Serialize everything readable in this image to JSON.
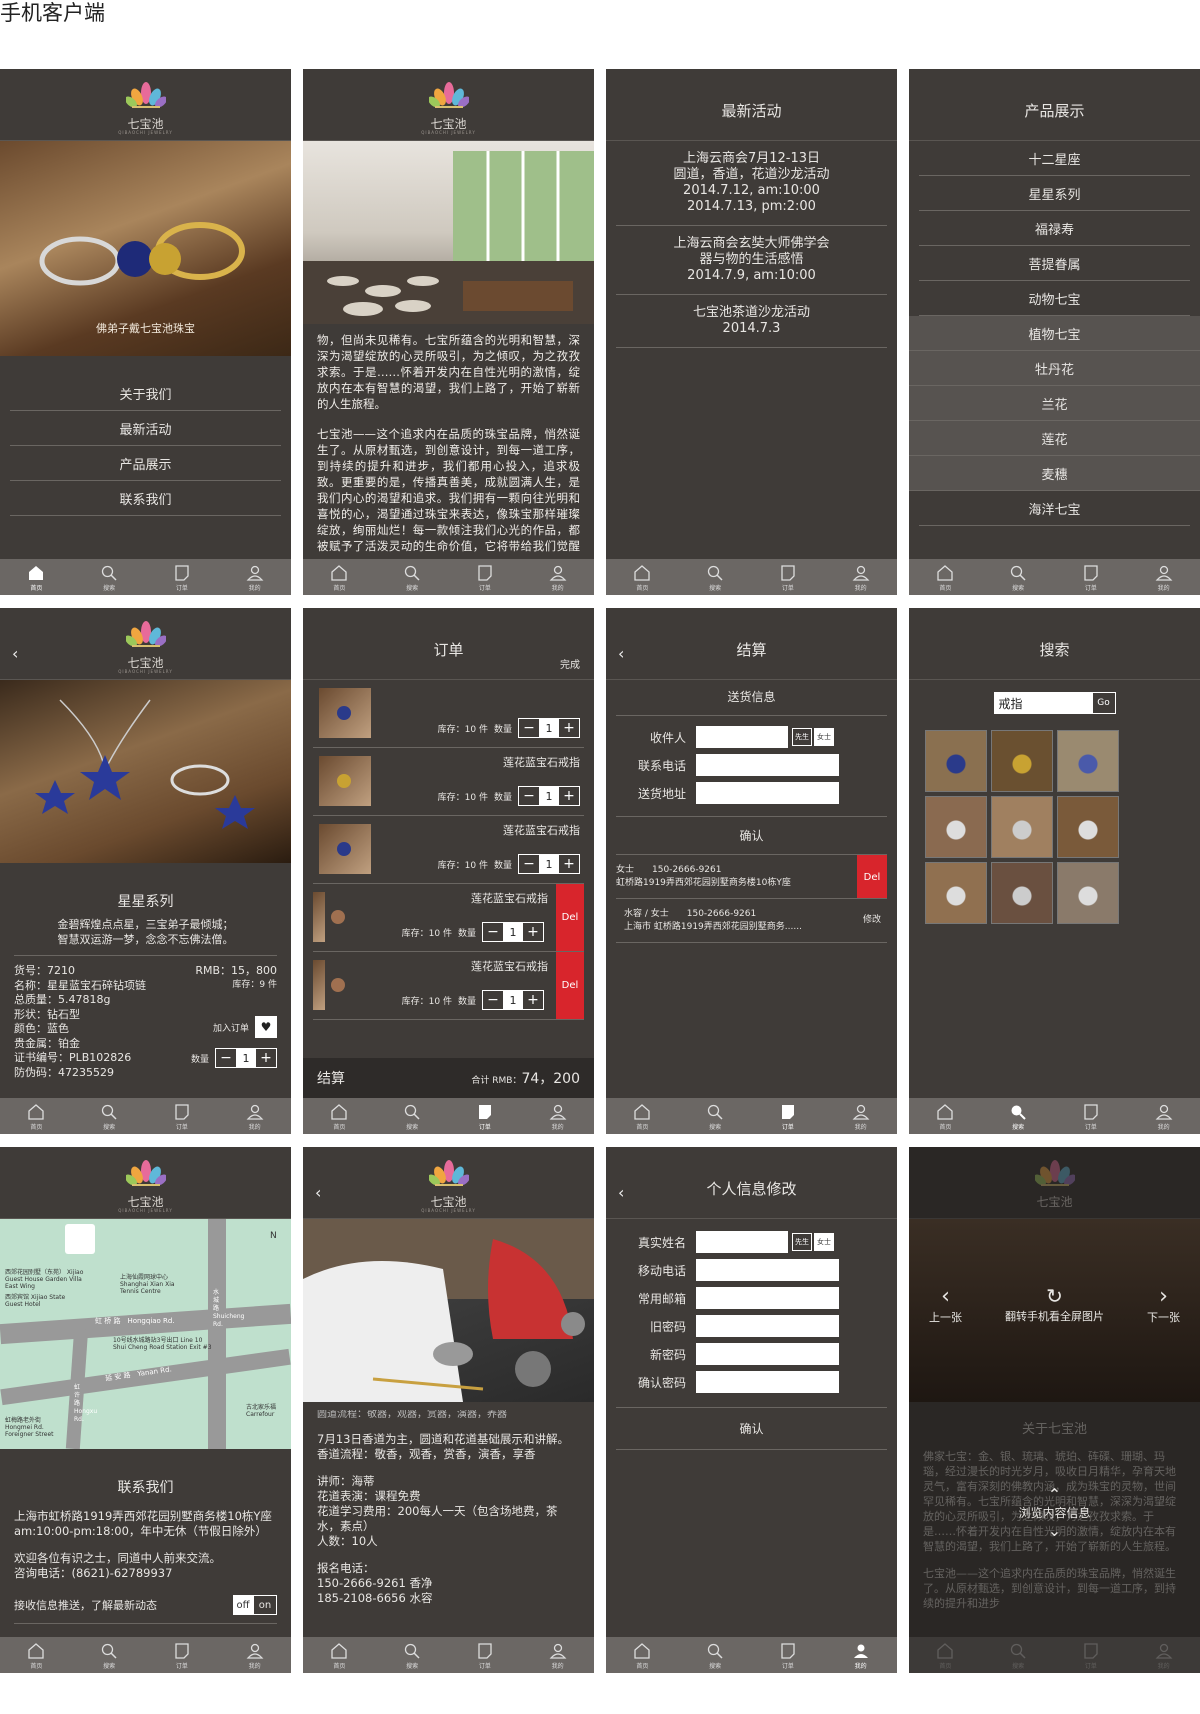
{
  "page_title": "手机客户端",
  "brand": {
    "name": "七宝池",
    "sub": "QIBAOCHI JEWELRY"
  },
  "tabs": [
    {
      "label": "首页",
      "icon": "home-icon"
    },
    {
      "label": "搜索",
      "icon": "search-icon"
    },
    {
      "label": "订单",
      "icon": "order-icon"
    },
    {
      "label": "我的",
      "icon": "user-icon"
    }
  ],
  "home": {
    "photo_caption": "佛弟子戴七宝池珠宝",
    "menu": [
      "关于我们",
      "最新活动",
      "产品展示",
      "联系我们"
    ]
  },
  "about": {
    "p1": "物，但尚未见稀有。七宝所蕴含的光明和智慧，深深为渴望绽放的心灵所吸引，为之倾叹，为之孜孜求索。于是……怀着开发内在自性光明的激情，绽放内在本有智慧的渴望，我们上路了，开始了崭新的人生旅程。",
    "p2": "七宝池——这个追求内在品质的珠宝品牌，悄然诞生了。从原材甄选，到创意设计，到每一道工序，到持续的提升和进步，我们都用心投入，追求极致。更重要的是，传播真善美，成就圆满人生，是我们内心的渴望和追求。我们拥有一颗向往光明和喜悦的心，渴望通过珠宝来表达，像珠宝那样璀璨绽放，绚丽灿烂！每一款倾注我们心光的作品，都被赋予了活泼灵动的生命价值，它将带给我们觉醒和智慧的光芒，启发我们去轻松更加幸福圆满的人"
  },
  "events": {
    "title": "最新活动",
    "items": [
      [
        "上海云商会7月12-13日",
        "圆道，香道，花道沙龙活动",
        "2014.7.12, am:10:00",
        "2014.7.13, pm:2:00"
      ],
      [
        "上海云商会玄奘大师佛学会",
        "器与物的生活感悟",
        "2014.7.9, am:10:00"
      ],
      [
        "七宝池茶道沙龙活动",
        "2014.7.3"
      ]
    ]
  },
  "products": {
    "title": "产品展示",
    "items": [
      "十二星座",
      "星星系列",
      "福禄寿",
      "菩提眷属",
      "动物七宝",
      "植物七宝",
      "牡丹花",
      "兰花",
      "莲花",
      "麦穗",
      "海洋七宝"
    ]
  },
  "detail": {
    "series": "星星系列",
    "poem1": "金碧辉煌点点星，三宝弟子最倾城；",
    "poem2": "智慧双运游一梦，念念不忘佛法僧。",
    "price": "RMB：15，800",
    "stock": "库存：9 件",
    "specs": [
      "货号：7210",
      "名称：星星蓝宝石碎钻项链",
      "总质量：5.47818g",
      "形状：钻石型",
      "颜色：蓝色",
      "贵金属：铂金",
      "证书编号：PLB102826",
      "防伪码：47235529"
    ],
    "add_cart": "加入订单",
    "qty_label": "数量",
    "qty": "1"
  },
  "cart": {
    "title": "订单",
    "done": "完成",
    "item_name": "莲花蓝宝石戒指",
    "stock": "库存：10 件",
    "qty_label": "数量",
    "qty": "1",
    "del": "Del",
    "checkout": "结算",
    "total_label": "合计 RMB：",
    "total": "74，200"
  },
  "checkout": {
    "title": "结算",
    "section": "送货信息",
    "fields": [
      "收件人",
      "联系电话",
      "送货地址"
    ],
    "mr": "先生",
    "ms": "女士",
    "confirm": "确认",
    "addr1_line1": "女士　　150-2666-9261",
    "addr1_line2": "虹桥路1919弄西郊花园别墅商务楼10栋Y座",
    "addr2_line1": "水容 / 女士　　150-2666-9261",
    "addr2_line2": "上海市 虹桥路1919弄西郊花园别墅商务......",
    "edit": "修改",
    "del": "Del"
  },
  "search": {
    "title": "搜索",
    "value": "戒指",
    "go": "Go"
  },
  "contact": {
    "title": "联系我们",
    "addr": "上海市虹桥路1919弄西郊花园别墅商务楼10栋Y座",
    "hours": "am:10:00-pm:18:00，年中无休（节假日除外）",
    "welcome": "欢迎各位有识之士，同道中人前来交流。",
    "phone": "咨询电话：(8621)-62789937",
    "push": "接收信息推送，了解最新动态",
    "off": "off",
    "on": "on",
    "map": {
      "hotel1": "西郊宾馆 Xijiao State Guest Hotel",
      "hotel2": "西郊花园别墅（东苑） Xijiao Guest House Garden Villa East Wing",
      "tennis": "上海仙霞网球中心 Shanghai Xian Xia Tennis Centre",
      "road1": "虹 桥 路　Hongqiao Rd.",
      "road2": "延 安 路　Yanan Rd.",
      "road3": "水 城 路　Shuicheng Rd.",
      "metro": "10号线水城路站3号出口 Line 10 Shui Cheng Road Station Exit #3",
      "carrefour": "古北家乐福 Carrefour",
      "market": "虹梅路老外街 Hongmei Rd. Foreigner Street",
      "road4": "虹 许 路 Hongxu Rd.",
      "north": "N"
    }
  },
  "activity": {
    "p0": "圆道流程：敬器，观器，赏器，演器，养器",
    "p1": "7月13日香道为主，圆道和花道基础展示和讲解。香道流程：敬香，观香，赏香，演香，享香",
    "p2": [
      "讲师：海蒂",
      "花道表演：课程免费",
      "花道学习费用：200每人一天（包含场地费，茶水，素点）",
      "人数：10人"
    ],
    "p3": [
      "报名电话：",
      "150-2666-9261 香净",
      "185-2108-6656 水容"
    ]
  },
  "profile": {
    "title": "个人信息修改",
    "fields": [
      "真实姓名",
      "移动电话",
      "常用邮箱",
      "旧密码",
      "新密码",
      "确认密码"
    ],
    "mr": "先生",
    "ms": "女士",
    "confirm": "确认"
  },
  "gallery": {
    "prev": "上一张",
    "rotate": "翻转手机看全屏图片",
    "next": "下一张",
    "about_title": "关于七宝池",
    "browse": "浏览内容信息",
    "p1": "佛家七宝：金、银、琉璃、琥珀、砗磲、珊瑚、玛瑙，经过漫长的时光岁月，吸收日月精华，孕育天地灵气，富有深刻的佛教内涵，成为珠宝的灵物，世间罕见稀有。七宝所蕴含的光明和智慧，深深为渴望绽放的心灵所吸引，为之倾叹，为之孜孜求索。于是……怀着开发内在自性光明的激情，绽放内在本有智慧的渴望，我们上路了，开始了崭新的人生旅程。",
    "p2": "七宝池——这个追求内在品质的珠宝品牌，悄然诞生了。从原材甄选，到创意设计，到每一道工序，到持续的提升和进步"
  }
}
